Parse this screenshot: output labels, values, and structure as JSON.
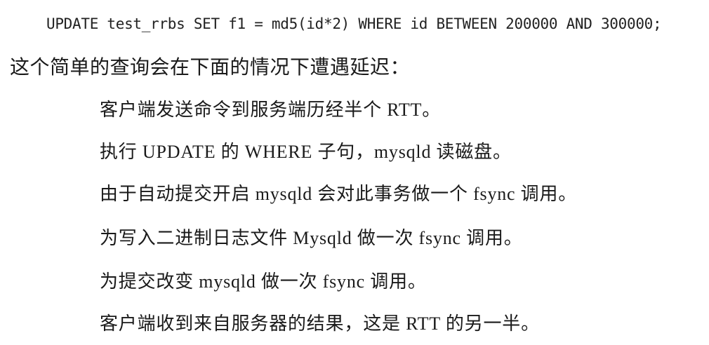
{
  "code": "UPDATE test_rrbs SET f1 = md5(id*2) WHERE id BETWEEN 200000 AND 300000;",
  "intro": "这个简单的查询会在下面的情况下遭遇延迟：",
  "steps": [
    "客户端发送命令到服务端历经半个 RTT。",
    "执行 UPDATE 的 WHERE 子句，mysqld 读磁盘。",
    "由于自动提交开启 mysqld 会对此事务做一个 fsync 调用。",
    "为写入二进制日志文件 Mysqld 做一次 fsync 调用。",
    "为提交改变 mysqld 做一次 fsync 调用。",
    "客户端收到来自服务器的结果，这是 RTT 的另一半。"
  ]
}
